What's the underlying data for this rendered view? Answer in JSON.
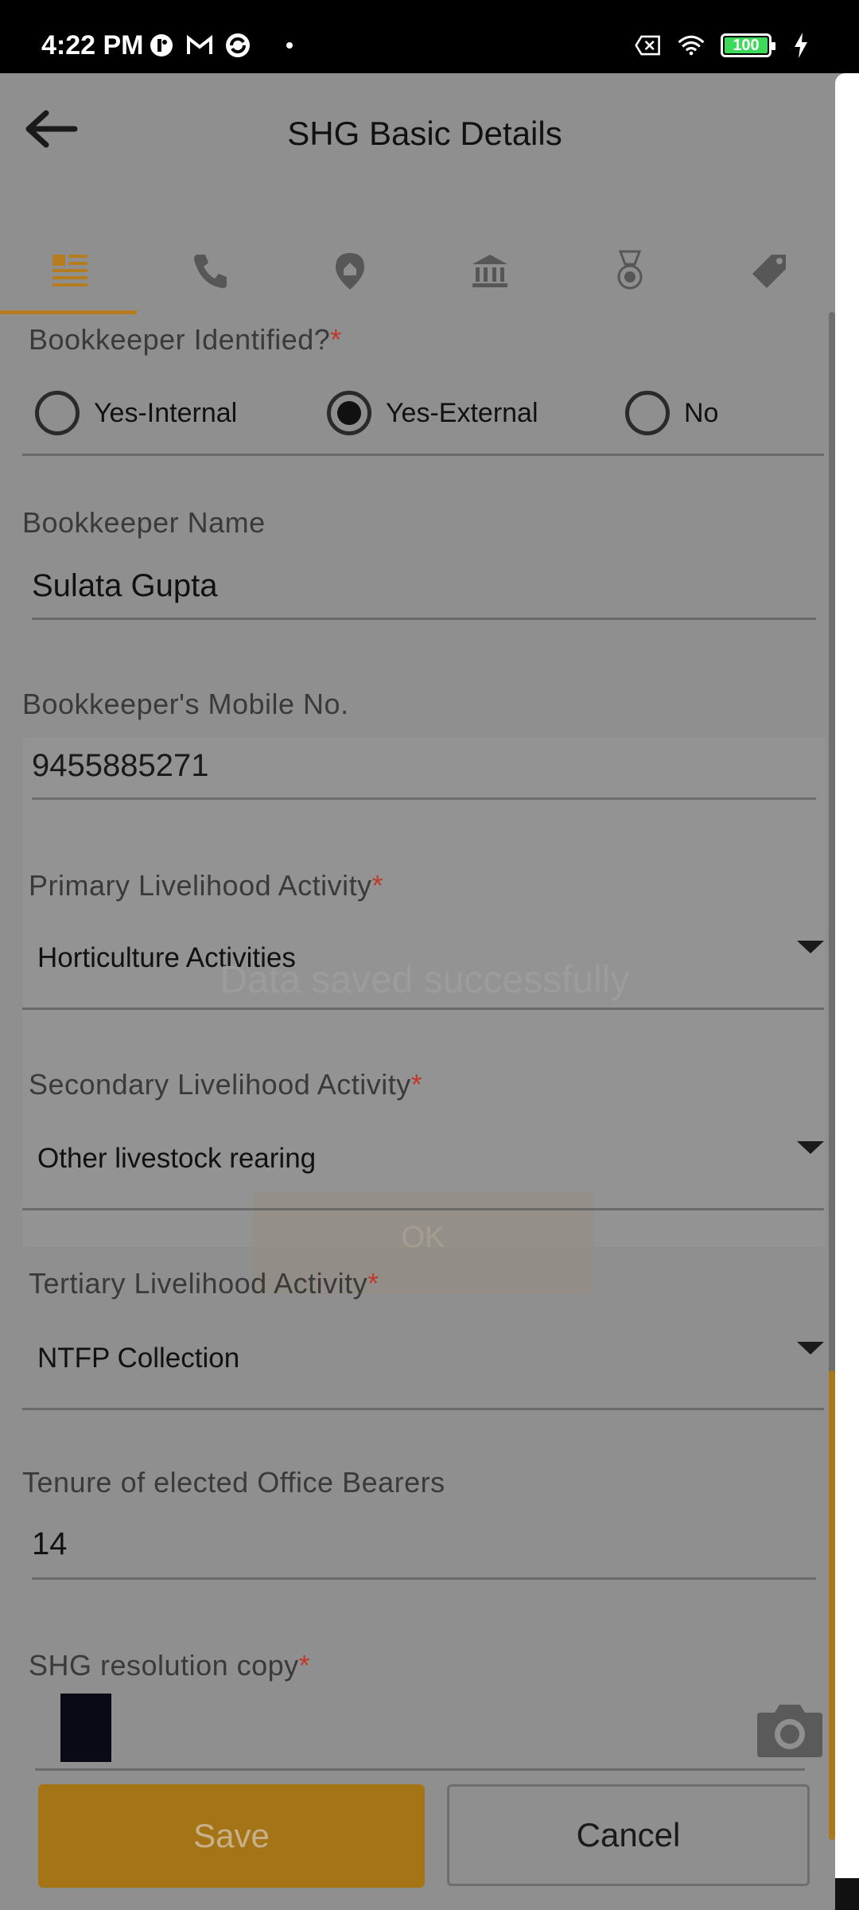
{
  "status_bar": {
    "time": "4:22 PM",
    "battery": "100",
    "icons": [
      "notification-icon",
      "gmail-icon",
      "sync-icon",
      "sim-off-icon",
      "wifi-icon",
      "battery-icon",
      "charging-icon"
    ]
  },
  "header": {
    "title": "SHG Basic Details"
  },
  "tabs": [
    {
      "name": "basic-details-icon",
      "active": true
    },
    {
      "name": "phone-icon",
      "active": false
    },
    {
      "name": "location-icon",
      "active": false
    },
    {
      "name": "bank-icon",
      "active": false
    },
    {
      "name": "medal-icon",
      "active": false
    },
    {
      "name": "tag-icon",
      "active": false
    }
  ],
  "form": {
    "bookkeeper_identified": {
      "label": "Bookkeeper Identified?",
      "required": "*",
      "options": [
        "Yes-Internal",
        "Yes-External",
        "No"
      ],
      "selected": "Yes-External"
    },
    "bookkeeper_name": {
      "label": "Bookkeeper Name",
      "value": "Sulata Gupta"
    },
    "bookkeeper_mobile": {
      "label": "Bookkeeper's Mobile No.",
      "value": "9455885271"
    },
    "primary_livelihood": {
      "label": "Primary Livelihood Activity",
      "required": "*",
      "value": "Horticulture Activities"
    },
    "secondary_livelihood": {
      "label": "Secondary Livelihood Activity",
      "required": "*",
      "value": "Other livestock rearing"
    },
    "tertiary_livelihood": {
      "label": "Tertiary Livelihood Activity",
      "required": "*",
      "value": "NTFP Collection"
    },
    "tenure": {
      "label": "Tenure of elected Office Bearers",
      "value": "14"
    },
    "resolution_copy": {
      "label": "SHG resolution copy",
      "required": "*"
    }
  },
  "dialog": {
    "message": "Data saved successfully",
    "ok_label": "OK"
  },
  "actions": {
    "save_label": "Save",
    "cancel_label": "Cancel"
  },
  "colors": {
    "accent": "#a57416",
    "overlay": "#8f8f8f",
    "required": "#c0392b"
  }
}
